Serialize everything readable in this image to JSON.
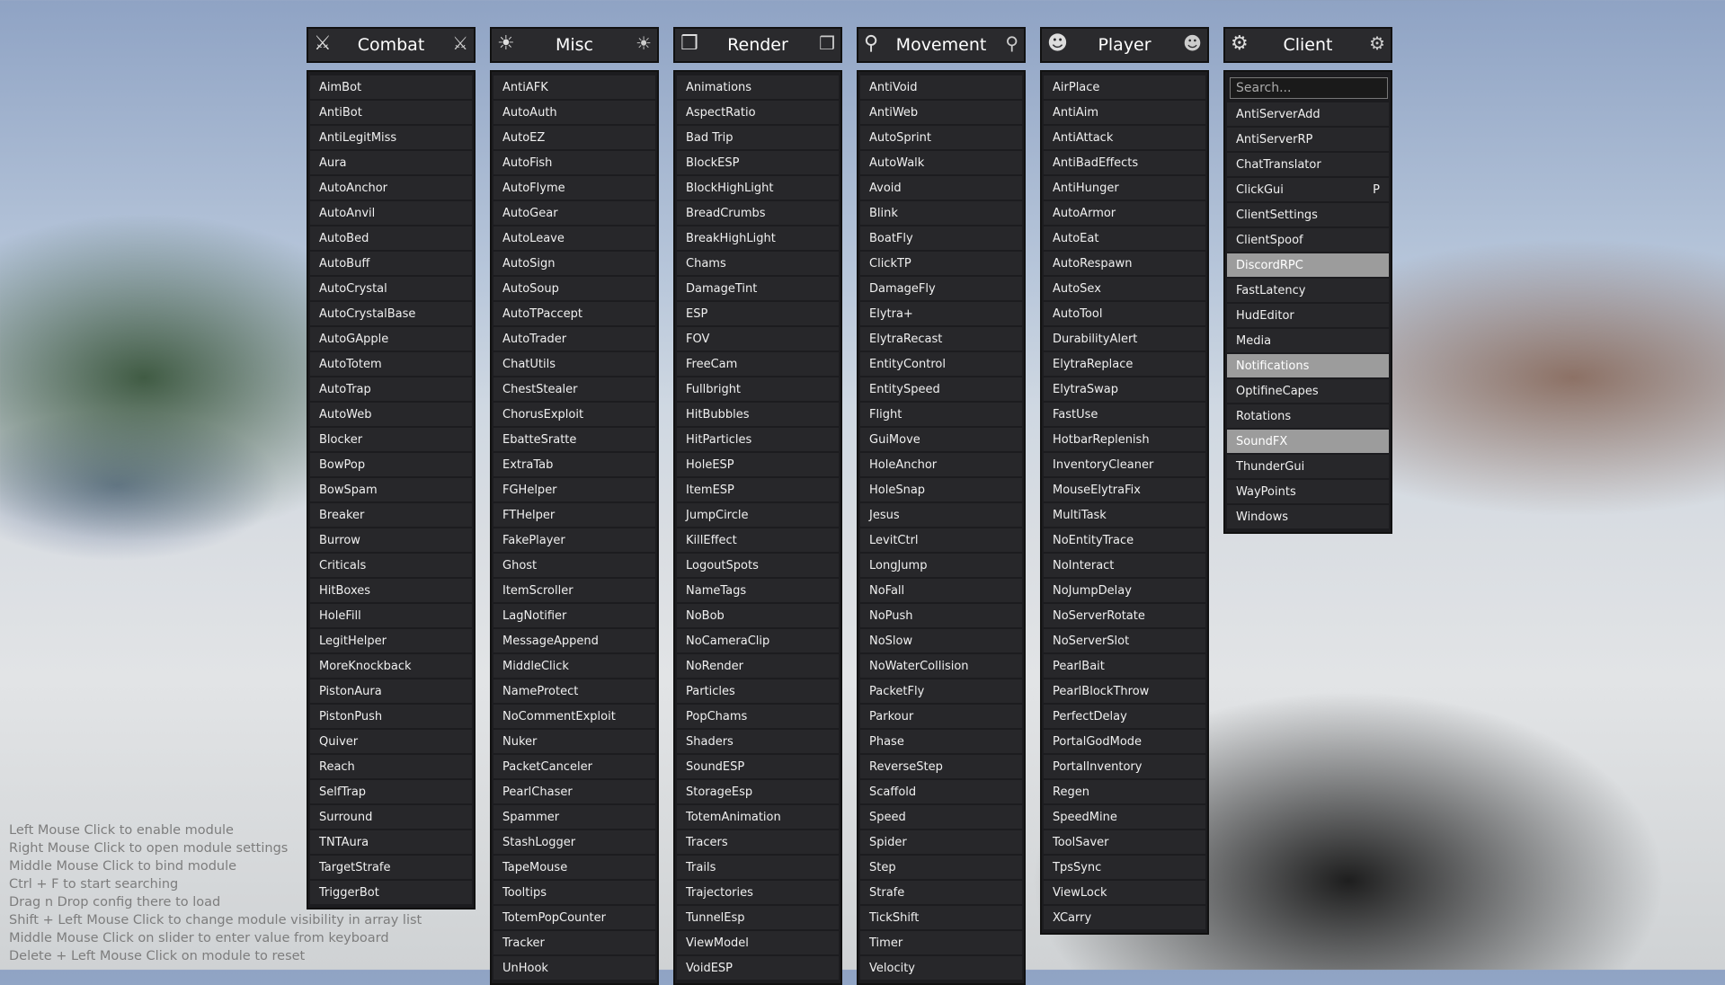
{
  "panels": [
    {
      "title": "Combat",
      "icon": "sword-icon",
      "items": [
        "AimBot",
        "AntiBot",
        "AntiLegitMiss",
        "Aura",
        "AutoAnchor",
        "AutoAnvil",
        "AutoBed",
        "AutoBuff",
        "AutoCrystal",
        "AutoCrystalBase",
        "AutoGApple",
        "AutoTotem",
        "AutoTrap",
        "AutoWeb",
        "Blocker",
        "BowPop",
        "BowSpam",
        "Breaker",
        "Burrow",
        "Criticals",
        "HitBoxes",
        "HoleFill",
        "LegitHelper",
        "MoreKnockback",
        "PistonAura",
        "PistonPush",
        "Quiver",
        "Reach",
        "SelfTrap",
        "Surround",
        "TNTAura",
        "TargetStrafe",
        "TriggerBot"
      ]
    },
    {
      "title": "Misc",
      "icon": "lightbulb-icon",
      "items": [
        "AntiAFK",
        "AutoAuth",
        "AutoEZ",
        "AutoFish",
        "AutoFlyme",
        "AutoGear",
        "AutoLeave",
        "AutoSign",
        "AutoSoup",
        "AutoTPaccept",
        "AutoTrader",
        "ChatUtils",
        "ChestStealer",
        "ChorusExploit",
        "EbatteSratte",
        "ExtraTab",
        "FGHelper",
        "FTHelper",
        "FakePlayer",
        "Ghost",
        "ItemScroller",
        "LagNotifier",
        "MessageAppend",
        "MiddleClick",
        "NameProtect",
        "NoCommentExploit",
        "Nuker",
        "PacketCanceler",
        "PearlChaser",
        "Spammer",
        "StashLogger",
        "TapeMouse",
        "Tooltips",
        "TotemPopCounter",
        "Tracker",
        "UnHook"
      ]
    },
    {
      "title": "Render",
      "icon": "cube-icon",
      "items": [
        "Animations",
        "AspectRatio",
        "Bad Trip",
        "BlockESP",
        "BlockHighLight",
        "BreadCrumbs",
        "BreakHighLight",
        "Chams",
        "DamageTint",
        "ESP",
        "FOV",
        "FreeCam",
        "Fullbright",
        "HitBubbles",
        "HitParticles",
        "HoleESP",
        "ItemESP",
        "JumpCircle",
        "KillEffect",
        "LogoutSpots",
        "NameTags",
        "NoBob",
        "NoCameraClip",
        "NoRender",
        "Particles",
        "PopChams",
        "Shaders",
        "SoundESP",
        "StorageEsp",
        "TotemAnimation",
        "Tracers",
        "Trails",
        "Trajectories",
        "TunnelEsp",
        "ViewModel",
        "VoidESP"
      ]
    },
    {
      "title": "Movement",
      "icon": "runner-icon",
      "items": [
        "AntiVoid",
        "AntiWeb",
        "AutoSprint",
        "AutoWalk",
        "Avoid",
        "Blink",
        "BoatFly",
        "ClickTP",
        "DamageFly",
        "Elytra+",
        "ElytraRecast",
        "EntityControl",
        "EntitySpeed",
        "Flight",
        "GuiMove",
        "HoleAnchor",
        "HoleSnap",
        "Jesus",
        "LevitCtrl",
        "LongJump",
        "NoFall",
        "NoPush",
        "NoSlow",
        "NoWaterCollision",
        "PacketFly",
        "Parkour",
        "Phase",
        "ReverseStep",
        "Scaffold",
        "Speed",
        "Spider",
        "Step",
        "Strafe",
        "TickShift",
        "Timer",
        "Velocity"
      ]
    },
    {
      "title": "Player",
      "icon": "user-icon",
      "items": [
        "AirPlace",
        "AntiAim",
        "AntiAttack",
        "AntiBadEffects",
        "AntiHunger",
        "AutoArmor",
        "AutoEat",
        "AutoRespawn",
        "AutoSex",
        "AutoTool",
        "DurabilityAlert",
        "ElytraReplace",
        "ElytraSwap",
        "FastUse",
        "HotbarReplenish",
        "InventoryCleaner",
        "MouseElytraFix",
        "MultiTask",
        "NoEntityTrace",
        "NoInteract",
        "NoJumpDelay",
        "NoServerRotate",
        "NoServerSlot",
        "PearlBait",
        "PearlBlockThrow",
        "PerfectDelay",
        "PortalGodMode",
        "PortalInventory",
        "Regen",
        "SpeedMine",
        "ToolSaver",
        "TpsSync",
        "ViewLock",
        "XCarry"
      ]
    },
    {
      "title": "Client",
      "icon": "gear-icon",
      "search_placeholder": "Search...",
      "items": [
        "AntiServerAdd",
        "AntiServerRP",
        "ChatTranslator",
        "ClickGui",
        "ClientSettings",
        "ClientSpoof",
        "DiscordRPC",
        "FastLatency",
        "HudEditor",
        "Media",
        "Notifications",
        "OptifineCapes",
        "Rotations",
        "SoundFX",
        "ThunderGui",
        "WayPoints",
        "Windows"
      ],
      "active": [
        "DiscordRPC",
        "Notifications",
        "SoundFX"
      ],
      "binds": {
        "ClickGui": "P"
      }
    }
  ],
  "hints": [
    "Left Mouse Click to enable module",
    "Right Mouse Click to open module settings",
    "Middle Mouse Click to bind module",
    "Ctrl + F to start searching",
    "Drag n Drop config there to load",
    "Shift + Left Mouse Click to change module visibility in array list",
    "Middle Mouse Click on slider to enter value from keyboard",
    "Delete + Left Mouse Click on module to reset"
  ]
}
